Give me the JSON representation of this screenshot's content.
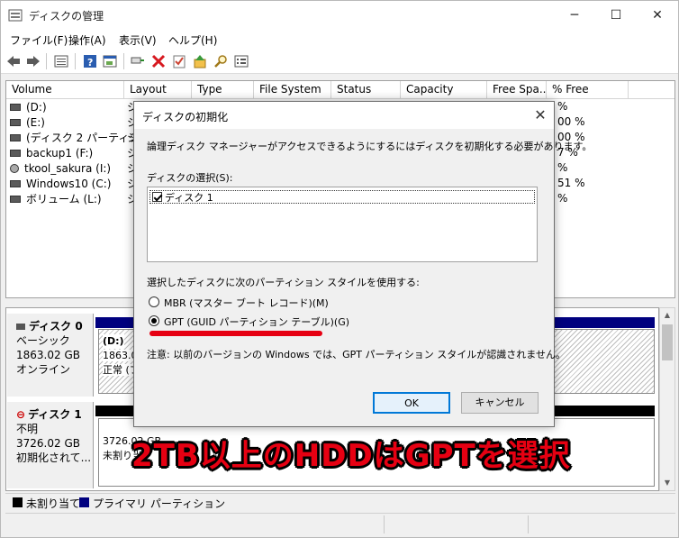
{
  "window": {
    "title": "ディスクの管理"
  },
  "menu": [
    "ファイル(F)",
    "操作(A)",
    "表示(V)",
    "ヘルプ(H)"
  ],
  "toolbar_icons": [
    "back-icon",
    "forward-icon",
    "disk-list-icon",
    "help-icon",
    "properties-icon",
    "connect-icon",
    "delete-icon",
    "check-icon",
    "up-icon",
    "search-icon",
    "view-icon"
  ],
  "volume_list": {
    "columns": [
      "Volume",
      "Layout",
      "Type",
      "File System",
      "Status",
      "Capacity",
      "Free Spa...",
      "% Free"
    ],
    "rows": [
      {
        "volume": "(D:)",
        "layout": "シ",
        "pct": "%"
      },
      {
        "volume": "(E:)",
        "layout": "シ",
        "pct": "00 %"
      },
      {
        "volume": "(ディスク 2 パーティシ...",
        "layout": "シ",
        "pct": "00 %"
      },
      {
        "volume": "backup1 (F:)",
        "layout": "シ",
        "pct": "7 %"
      },
      {
        "volume": "tkool_sakura (I:)",
        "layout": "シ",
        "pct": "%"
      },
      {
        "volume": "Windows10 (C:)",
        "layout": "シ",
        "pct": "51 %"
      },
      {
        "volume": "ボリューム (L:)",
        "layout": "シ",
        "pct": "%"
      }
    ]
  },
  "disks": [
    {
      "name": "ディスク 0",
      "type": "ベーシック",
      "size": "1863.02 GB",
      "status": "オンライン",
      "vol_label": "(D:)",
      "vol_size": "1863.01",
      "vol_status": "正常 (フ"
    },
    {
      "name": "ディスク 1",
      "type": "不明",
      "size": "3726.02 GB",
      "status": "初期化されて...",
      "vol_size": "3726.02 GB",
      "vol_status": "未割り当"
    }
  ],
  "legend": {
    "unallocated": "未割り当て",
    "primary": "プライマリ パーティション"
  },
  "dialog": {
    "title": "ディスクの初期化",
    "message": "論理ディスク マネージャーがアクセスできるようにするにはディスクを初期化する必要があります。",
    "select_label": "ディスクの選択(S):",
    "disk_item": "ディスク 1",
    "style_label": "選択したディスクに次のパーティション スタイルを使用する:",
    "mbr": "MBR (マスター ブート レコード)(M)",
    "gpt": "GPT (GUID パーティション テーブル)(G)",
    "note": "注意: 以前のバージョンの Windows では、GPT パーティション スタイルが認識されません。",
    "ok": "OK",
    "cancel": "キャンセル"
  },
  "annotation": "2TB以上のHDDはGPTを選択",
  "colors": {
    "accent": "#0078d7",
    "primary_partition": "#00007f",
    "annotation_red": "#e60012"
  }
}
